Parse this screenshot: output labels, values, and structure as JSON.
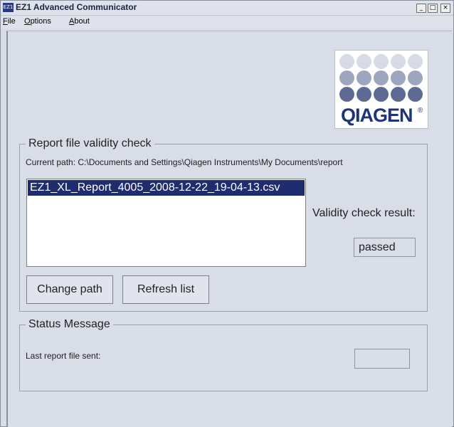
{
  "window": {
    "icon_text": "EZ1",
    "title": "EZ1 Advanced Communicator",
    "buttons": {
      "minimize": "_",
      "maximize": "□",
      "close": "×"
    }
  },
  "menu": {
    "items": [
      {
        "accel": "F",
        "rest": "ile"
      },
      {
        "accel": "O",
        "rest": "ptions"
      },
      {
        "accel": "A",
        "rest": "bout"
      }
    ]
  },
  "logo": {
    "text": "QIAGEN",
    "registered": "®"
  },
  "report_check": {
    "title": "Report file validity check",
    "current_path": "Current path: C:\\Documents and Settings\\Qiagen Instruments\\My Documents\\report",
    "files": [
      "EZ1_XL_Report_4005_2008-12-22_19-04-13.csv"
    ],
    "result_label": "Validity check result:",
    "result_value": "passed",
    "change_path_label": "Change path",
    "refresh_list_label": "Refresh list"
  },
  "status": {
    "title": "Status Message",
    "last_sent_label": "Last report file sent:",
    "last_sent_value": ""
  },
  "colors": {
    "background": "#d9dde8",
    "selection": "#1f2d6e",
    "logo_blue": "#1f3478"
  }
}
